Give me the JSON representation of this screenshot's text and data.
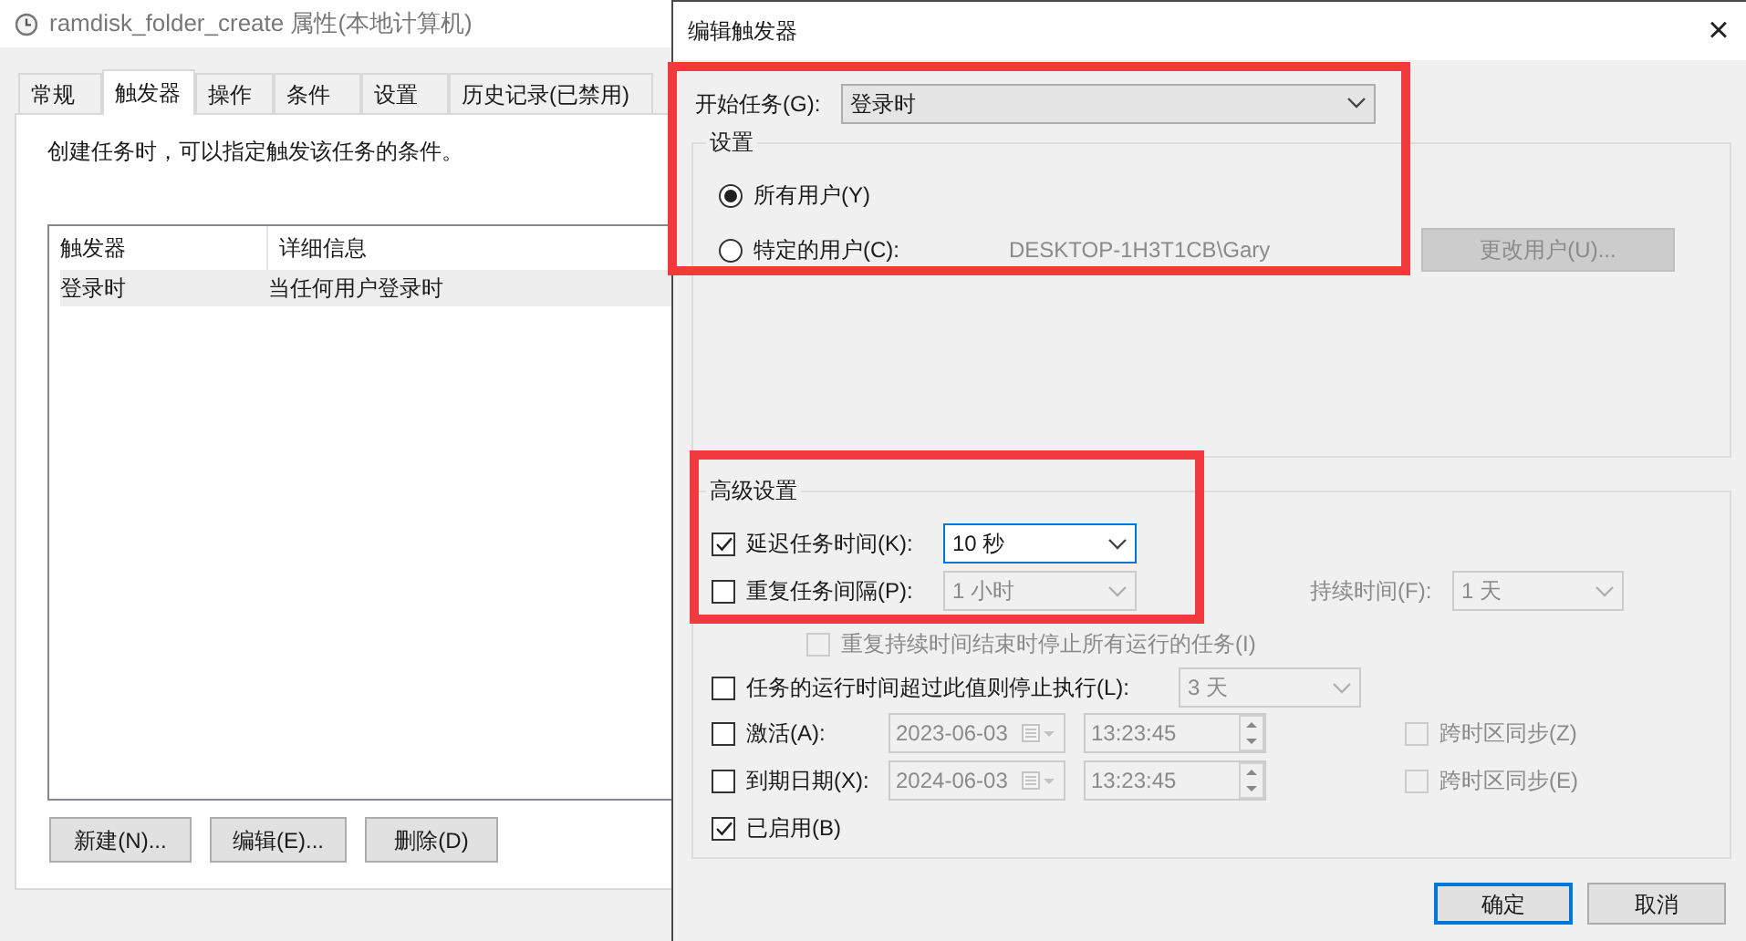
{
  "properties_window": {
    "title": "ramdisk_folder_create 属性(本地计算机)",
    "tabs": [
      {
        "label": "常规",
        "selected": false
      },
      {
        "label": "触发器",
        "selected": true
      },
      {
        "label": "操作",
        "selected": false
      },
      {
        "label": "条件",
        "selected": false
      },
      {
        "label": "设置",
        "selected": false
      },
      {
        "label": "历史记录(已禁用)",
        "selected": false
      }
    ],
    "description": "创建任务时，可以指定触发该任务的条件。",
    "triggers_table": {
      "columns": [
        "触发器",
        "详细信息"
      ],
      "rows": [
        {
          "cells": [
            "登录时",
            "当任何用户登录时"
          ],
          "selected": true
        }
      ]
    },
    "buttons": [
      "新建(N)...",
      "编辑(E)...",
      "删除(D)"
    ]
  },
  "edit_trigger_dialog": {
    "title": "编辑触发器",
    "close": "×",
    "begin_task": {
      "label": "开始任务(G):",
      "value": "登录时"
    },
    "settings": {
      "title": "设置",
      "options": [
        {
          "label": "所有用户(Y)",
          "selected": true
        },
        {
          "label": "特定的用户(C):",
          "selected": false
        }
      ],
      "user": "DESKTOP-1H3T1CB\\Gary",
      "change_user_button": {
        "label": "更改用户(U)...",
        "disabled": true
      }
    },
    "advanced": {
      "title": "高级设置",
      "delay": {
        "label": "延迟任务时间(K):",
        "checked": true,
        "value": "10 秒",
        "disabled": false
      },
      "repeat": {
        "label": "重复任务间隔(P):",
        "checked": false,
        "value": "1 小时",
        "disabled": true,
        "duration_label": "持续时间(F):",
        "duration_value": "1 天"
      },
      "stop_at_end": {
        "label": "重复持续时间结束时停止所有运行的任务(I)",
        "checked": false,
        "disabled": true
      },
      "stop_if_longer": {
        "label": "任务的运行时间超过此值则停止执行(L):",
        "checked": false,
        "value": "3 天",
        "disabled": true
      },
      "dates": [
        {
          "label": "激活(A):",
          "checked": false,
          "date": "2023-06-03",
          "time": "13:23:45",
          "sync_label": "跨时区同步(Z)",
          "sync_checked": false,
          "disabled": true
        },
        {
          "label": "到期日期(X):",
          "checked": false,
          "date": "2024-06-03",
          "time": "13:23:45",
          "sync_label": "跨时区同步(E)",
          "sync_checked": false,
          "disabled": true
        }
      ],
      "enabled": {
        "label": "已启用(B)",
        "checked": true
      }
    },
    "buttons": [
      {
        "label": "确定",
        "default": true
      },
      {
        "label": "取消",
        "default": false
      }
    ]
  },
  "annotations": [
    {
      "kind": "rectangle"
    },
    {
      "kind": "rectangle"
    }
  ]
}
